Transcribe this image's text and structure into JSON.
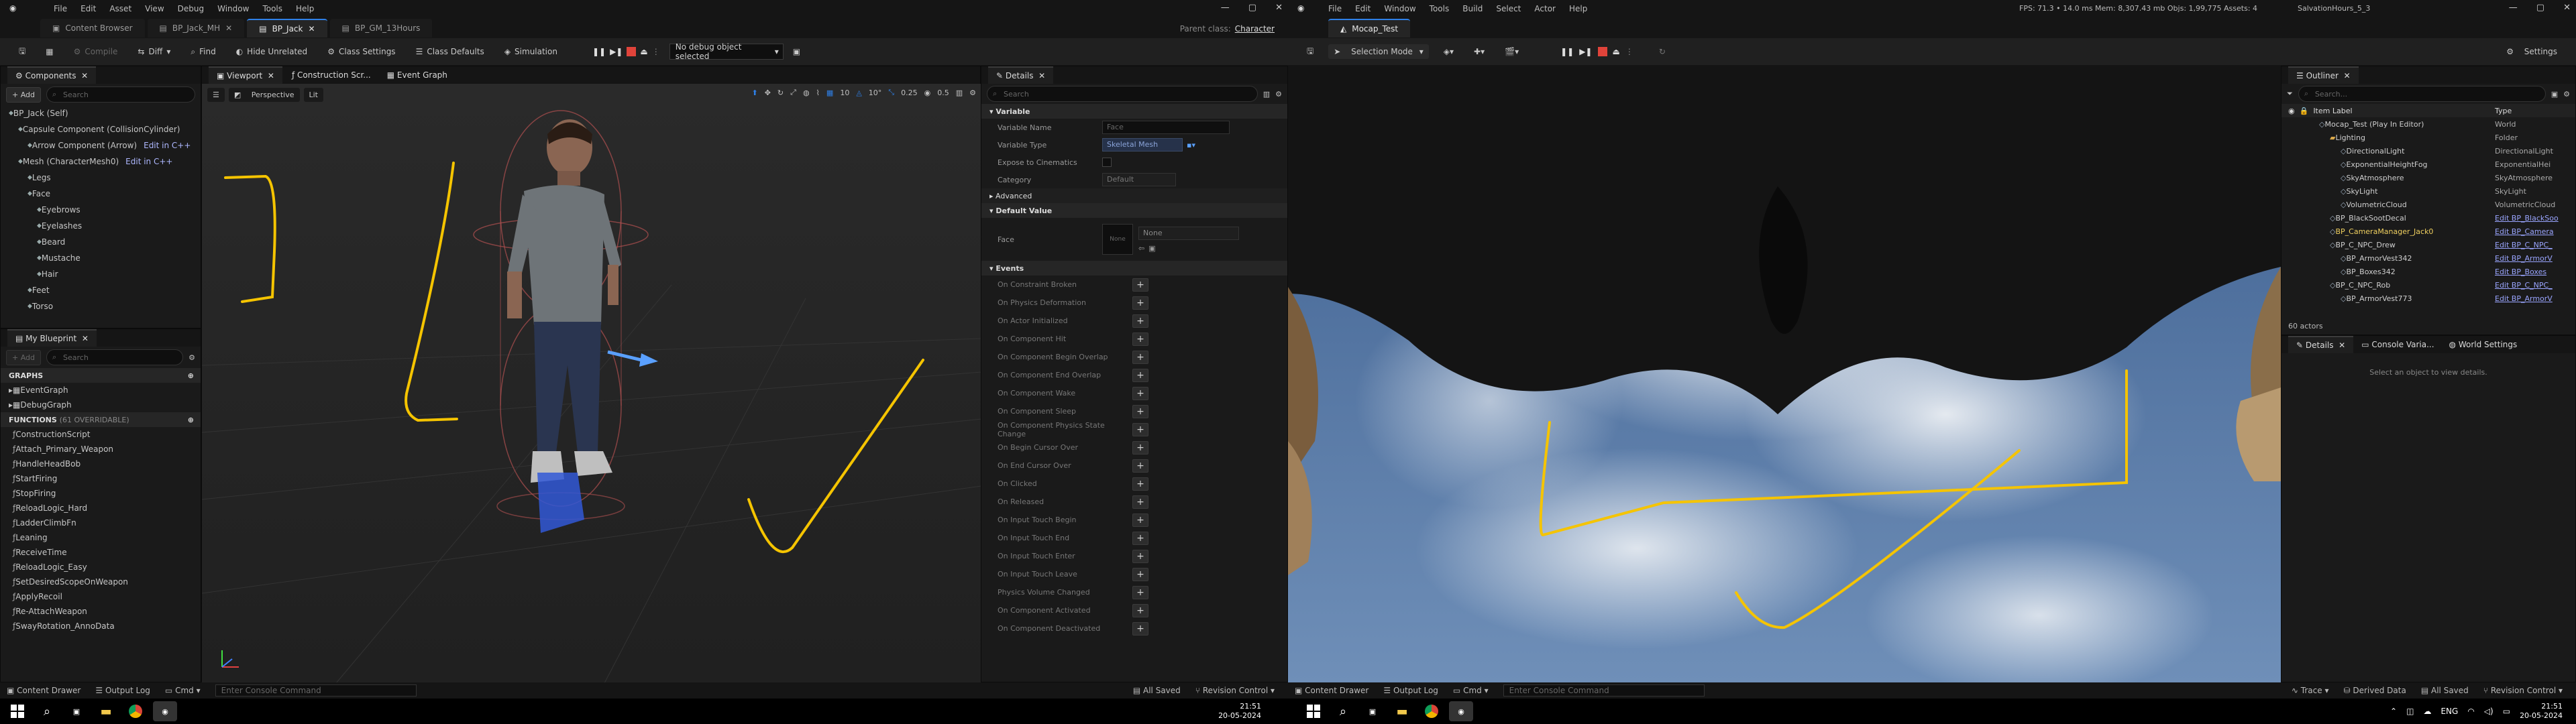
{
  "left": {
    "menu": [
      "File",
      "Edit",
      "Asset",
      "View",
      "Debug",
      "Window",
      "Tools",
      "Help"
    ],
    "tabs": [
      "Content Browser",
      "BP_Jack_MH",
      "BP_Jack",
      "BP_GM_13Hours"
    ],
    "parent_class_label": "Parent class:",
    "parent_class_value": "Character",
    "toolbar": {
      "compile": "Compile",
      "diff": "Diff",
      "find": "Find",
      "hide_unrelated": "Hide Unrelated",
      "class_settings": "Class Settings",
      "class_defaults": "Class Defaults",
      "simulation": "Simulation",
      "debug_select": "No debug object selected"
    },
    "components": {
      "title": "Components",
      "add": "+ Add",
      "search_ph": "Search",
      "items": [
        {
          "label": "BP_Jack (Self)",
          "edit": ""
        },
        {
          "label": "Capsule Component (CollisionCylinder)",
          "edit": ""
        },
        {
          "label": "Arrow Component (Arrow)",
          "edit": "Edit in C++"
        },
        {
          "label": "Mesh (CharacterMesh0)",
          "edit": "Edit in C++"
        },
        {
          "label": "Legs",
          "edit": ""
        },
        {
          "label": "Face",
          "edit": ""
        },
        {
          "label": "Eyebrows",
          "edit": ""
        },
        {
          "label": "Eyelashes",
          "edit": ""
        },
        {
          "label": "Beard",
          "edit": ""
        },
        {
          "label": "Mustache",
          "edit": ""
        },
        {
          "label": "Hair",
          "edit": ""
        },
        {
          "label": "Feet",
          "edit": ""
        },
        {
          "label": "Torso",
          "edit": ""
        }
      ]
    },
    "blueprint": {
      "title": "My Blueprint",
      "add": "+ Add",
      "search_ph": "Search",
      "graphs_header": "GRAPHS",
      "graphs": [
        "EventGraph",
        "DebugGraph"
      ],
      "functions_header": "FUNCTIONS",
      "functions_sub": "(61 OVERRIDABLE)",
      "functions": [
        "ConstructionScript",
        "Attach_Primary_Weapon",
        "HandleHeadBob",
        "StartFiring",
        "StopFiring",
        "ReloadLogic_Hard",
        "LadderClimbFn",
        "Leaning",
        "ReceiveTime",
        "ReloadLogic_Easy",
        "SetDesiredScopeOnWeapon",
        "ApplyRecoil",
        "Re-AttachWeapon",
        "SwayRotation_AnnoData"
      ]
    },
    "viewport": {
      "tabs": [
        "Viewport",
        "Construction Scr...",
        "Event Graph"
      ],
      "perspective": "Perspective",
      "lit": "Lit",
      "grid_val": "10",
      "rot_val": "10°",
      "scale_val": "0.25",
      "cam_val": "0.5"
    },
    "details": {
      "title": "Details",
      "search_ph": "Search",
      "variable_header": "Variable",
      "variable_name_label": "Variable Name",
      "variable_name_value": "Face",
      "variable_type_label": "Variable Type",
      "variable_type_value": "Skeletal Mesh",
      "expose_label": "Expose to Cinematics",
      "category_label": "Category",
      "category_value": "Default",
      "advanced": "Advanced",
      "default_header": "Default Value",
      "face_label": "Face",
      "face_thumb": "None",
      "face_value": "None",
      "events_header": "Events",
      "events": [
        "On Constraint Broken",
        "On Physics Deformation",
        "On Actor Initialized",
        "On Component Hit",
        "On Component Begin Overlap",
        "On Component End Overlap",
        "On Component Wake",
        "On Component Sleep",
        "On Component Physics State Change",
        "On Begin Cursor Over",
        "On End Cursor Over",
        "On Clicked",
        "On Released",
        "On Input Touch Begin",
        "On Input Touch End",
        "On Input Touch Enter",
        "On Input Touch Leave",
        "Physics Volume Changed",
        "On Component Activated",
        "On Component Deactivated"
      ]
    },
    "status": {
      "content_drawer": "Content Drawer",
      "output_log": "Output Log",
      "cmd": "Cmd",
      "console_ph": "Enter Console Command",
      "all_saved": "All Saved",
      "revision": "Revision Control"
    },
    "time": "21:51",
    "date": "20-05-2024"
  },
  "right": {
    "menu": [
      "File",
      "Edit",
      "Window",
      "Tools",
      "Build",
      "Select",
      "Actor",
      "Help"
    ],
    "project": "SalvationHours_5_3",
    "stats": "FPS: 71.3 • 14.0 ms  Mem: 8,307.43 mb  Objs: 1,99,775  Assets: 4",
    "tab": "Mocap_Test",
    "selection_mode": "Selection Mode",
    "settings": "Settings",
    "outliner": {
      "title": "Outliner",
      "search_ph": "Search...",
      "col_label": "Item Label",
      "col_type": "Type",
      "rows": [
        {
          "label": "Mocap_Test (Play In Editor)",
          "type": "World",
          "indent": 1
        },
        {
          "label": "Lighting",
          "type": "Folder",
          "indent": 2
        },
        {
          "label": "DirectionalLight",
          "type": "DirectionalLight",
          "indent": 3
        },
        {
          "label": "ExponentialHeightFog",
          "type": "ExponentialHei",
          "indent": 3
        },
        {
          "label": "SkyAtmosphere",
          "type": "SkyAtmosphere",
          "indent": 3
        },
        {
          "label": "SkyLight",
          "type": "SkyLight",
          "indent": 3
        },
        {
          "label": "VolumetricCloud",
          "type": "VolumetricCloud",
          "indent": 3
        },
        {
          "label": "BP_BlackSootDecal",
          "type": "Edit BP_BlackSoo",
          "indent": 2
        },
        {
          "label": "BP_CameraManager_Jack0",
          "type": "Edit BP_Camera",
          "indent": 2
        },
        {
          "label": "BP_C_NPC_Drew",
          "type": "Edit BP_C_NPC_",
          "indent": 2
        },
        {
          "label": "BP_ArmorVest342",
          "type": "Edit BP_ArmorV",
          "indent": 3
        },
        {
          "label": "BP_Boxes342",
          "type": "Edit BP_Boxes",
          "indent": 3
        },
        {
          "label": "BP_C_NPC_Rob",
          "type": "Edit BP_C_NPC_",
          "indent": 2
        },
        {
          "label": "BP_ArmorVest773",
          "type": "Edit BP_ArmorV",
          "indent": 3
        }
      ],
      "count": "60 actors"
    },
    "bottom_tabs": [
      "Details",
      "Console Varia...",
      "World Settings"
    ],
    "details_empty": "Select an object to view details.",
    "status": {
      "content_drawer": "Content Drawer",
      "output_log": "Output Log",
      "cmd": "Cmd",
      "console_ph": "Enter Console Command",
      "trace": "Trace",
      "derived": "Derived Data",
      "all_saved": "All Saved",
      "revision": "Revision Control"
    },
    "lang": "ENG",
    "time": "21:51",
    "date": "20-05-2024"
  },
  "colors": {
    "accent": "#2e80e8",
    "annotation": "#f5c400",
    "ue_bg": "#151515"
  }
}
